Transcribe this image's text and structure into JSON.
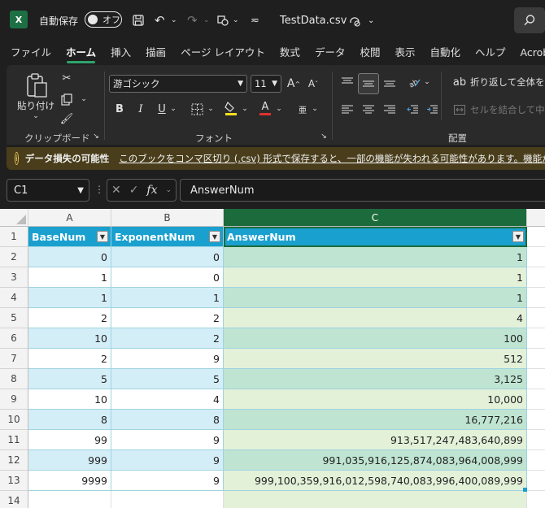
{
  "titlebar": {
    "app_icon": "X",
    "autosave_label": "自動保存",
    "autosave_state": "オフ",
    "filename": "TestData.csv",
    "icons": [
      "save-icon",
      "undo-icon",
      "redo-icon",
      "shape-icon",
      "more-icon",
      "search-icon"
    ]
  },
  "tabs": [
    "ファイル",
    "ホーム",
    "挿入",
    "描画",
    "ページ レイアウト",
    "数式",
    "データ",
    "校閲",
    "表示",
    "自動化",
    "ヘルプ",
    "Acrobat"
  ],
  "active_tab": "ホーム",
  "ribbon": {
    "paste_label": "貼り付け",
    "clipboard_label": "クリップボード",
    "font_name": "游ゴシック",
    "font_size": "11",
    "font_group_label": "フォント",
    "bold": "B",
    "italic": "I",
    "underline": "U",
    "font_color_glyph": "A",
    "phonetic_glyph": "亜",
    "grow_font": "A",
    "shrink_font": "A",
    "wrap_text": "折り返して全体を表",
    "merge_center": "セルを結合して中央",
    "alignment_label": "配置"
  },
  "infobar": {
    "title": "データ損失の可能性",
    "message": "このブックをコンマ区切り (.csv) 形式で保存すると、一部の機能が失われる可能性があります。機能が失われ"
  },
  "formula_bar": {
    "cell_ref": "C1",
    "fx_label": "fx",
    "content": "AnswerNum"
  },
  "grid": {
    "columns": [
      "A",
      "B",
      "C"
    ],
    "selected_column": "C",
    "row_numbers": [
      "1",
      "2",
      "3",
      "4",
      "5",
      "6",
      "7",
      "8",
      "9",
      "10",
      "11",
      "12",
      "13",
      "14"
    ],
    "headers": [
      "BaseNum",
      "ExponentNum",
      "AnswerNum"
    ],
    "rows": [
      [
        "0",
        "0",
        "1"
      ],
      [
        "1",
        "0",
        "1"
      ],
      [
        "1",
        "1",
        "1"
      ],
      [
        "2",
        "2",
        "4"
      ],
      [
        "10",
        "2",
        "100"
      ],
      [
        "2",
        "9",
        "512"
      ],
      [
        "5",
        "5",
        "3,125"
      ],
      [
        "10",
        "4",
        "10,000"
      ],
      [
        "8",
        "8",
        "16,777,216"
      ],
      [
        "99",
        "9",
        "913,517,247,483,640,899"
      ],
      [
        "999",
        "9",
        "991,035,916,125,874,083,964,008,999"
      ],
      [
        "9999",
        "9",
        "999,100,359,916,012,598,740,083,996,400,089,999"
      ]
    ]
  },
  "colors": {
    "header_blue": "#1aa0cf",
    "band_light": "#d4eef8",
    "band_c_even": "#bfe4d2",
    "band_c_odd": "#e3f1d9",
    "excel_green": "#1c6b3c"
  }
}
